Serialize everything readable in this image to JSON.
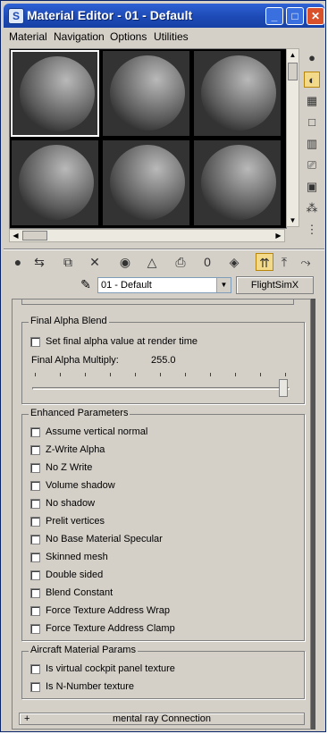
{
  "window": {
    "title": "Material Editor - 01 - Default"
  },
  "menu": [
    "Material",
    "Navigation",
    "Options",
    "Utilities"
  ],
  "material": {
    "name": "01 - Default",
    "type_button": "FlightSimX"
  },
  "final_alpha_blend": {
    "title": "Final Alpha Blend",
    "checkbox_label": "Set final alpha value at render time",
    "multiply_label": "Final Alpha Multiply:",
    "multiply_value": "255.0",
    "slider_fraction": 1.0
  },
  "enhanced_parameters": {
    "title": "Enhanced Parameters",
    "options": [
      "Assume vertical normal",
      "Z-Write Alpha",
      "No Z Write",
      "Volume shadow",
      "No shadow",
      "Prelit vertices",
      "No Base Material Specular",
      "Skinned mesh",
      "Double sided",
      "Blend Constant",
      "Force Texture Address Wrap",
      "Force Texture Address Clamp"
    ]
  },
  "aircraft_params": {
    "title": "Aircraft Material Params",
    "options": [
      "Is virtual cockpit panel texture",
      "Is N-Number texture"
    ]
  },
  "mental_ray": {
    "expand": "+",
    "label": "mental ray Connection"
  },
  "icons": {
    "window": "3dsmax-app-icon",
    "side": [
      "sample-type-sphere-icon",
      "backlight-icon",
      "background-checker-icon",
      "sample-uv-tiling-icon",
      "video-color-check-icon",
      "make-preview-icon",
      "options-icon",
      "select-by-material-icon",
      "material-map-navigator-icon"
    ],
    "toolbar": [
      "get-material-icon",
      "put-to-scene-icon",
      "assign-to-selection-icon",
      "reset-map-icon",
      "make-copy-icon",
      "make-unique-icon",
      "put-to-library-icon",
      "material-id-channel-icon",
      "show-map-in-viewport-icon",
      "show-end-result-icon",
      "go-to-parent-icon",
      "go-forward-to-sibling-icon"
    ]
  }
}
